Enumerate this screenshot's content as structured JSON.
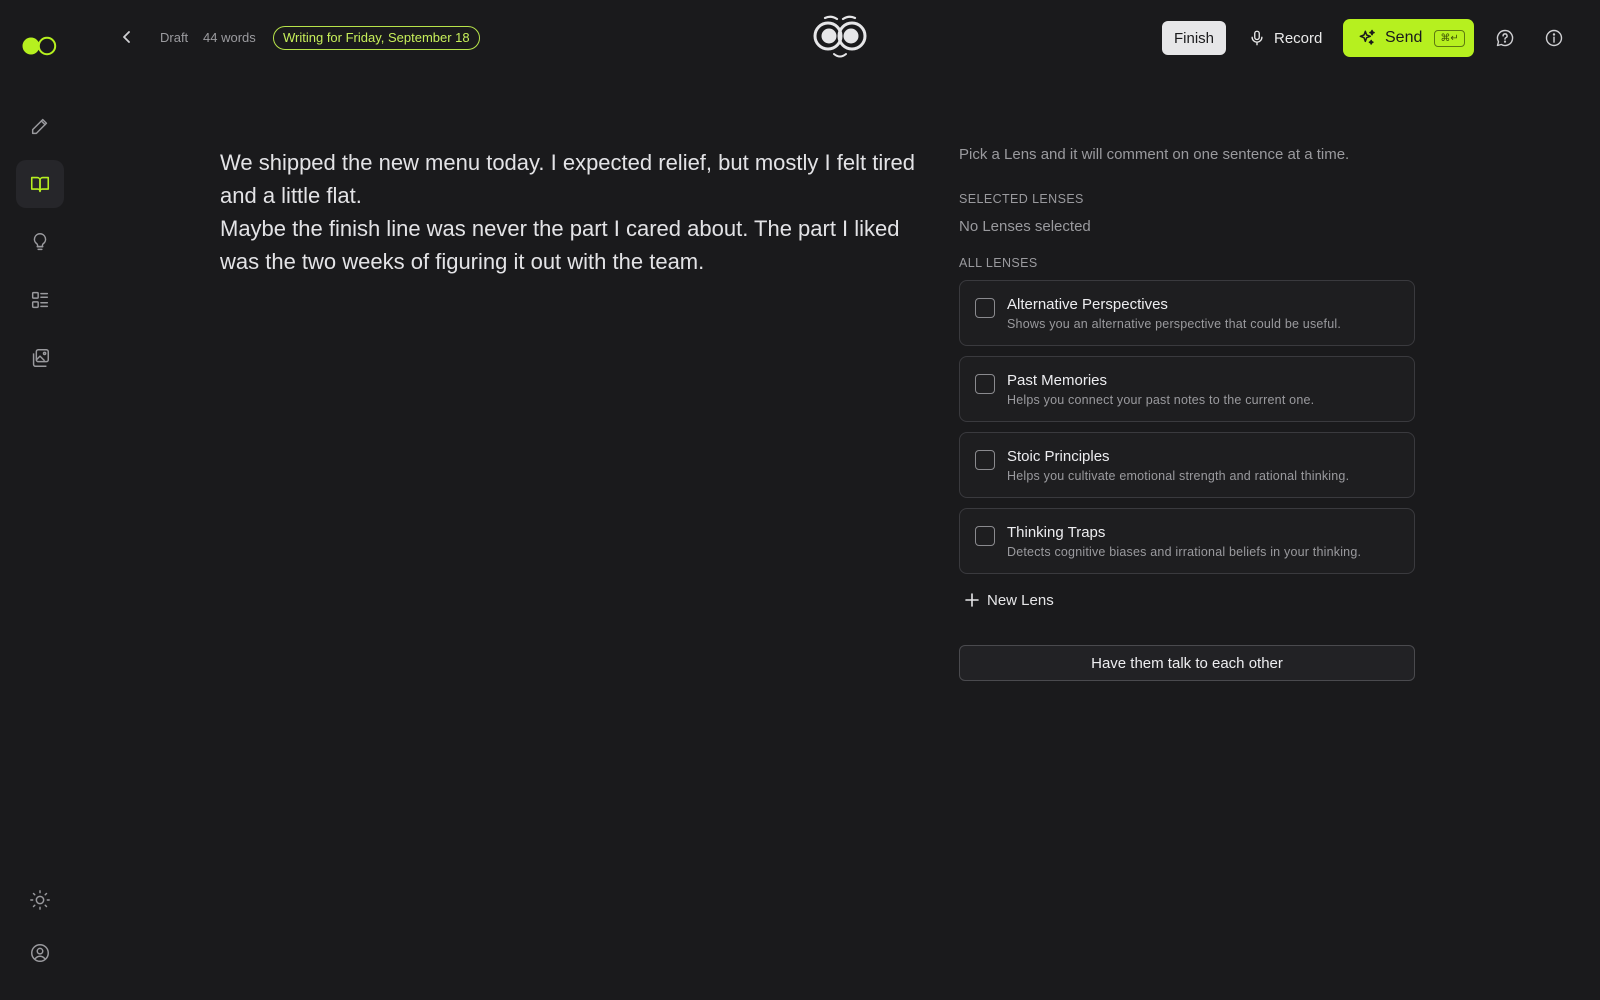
{
  "colors": {
    "background": "#1a1a1c",
    "accent": "#b6f01f",
    "accent_text": "#c7ef5a"
  },
  "sidebar": {
    "logo": "toggle-logo",
    "items": [
      {
        "icon": "pencil-icon",
        "name": "nav-write"
      },
      {
        "icon": "book-open-icon",
        "name": "nav-journal",
        "active": true
      },
      {
        "icon": "lightbulb-icon",
        "name": "nav-ideas"
      },
      {
        "icon": "list-icon",
        "name": "nav-lists"
      },
      {
        "icon": "gallery-icon",
        "name": "nav-media"
      }
    ],
    "bottom_items": [
      {
        "icon": "sun-icon",
        "name": "theme-toggle"
      },
      {
        "icon": "user-circle-icon",
        "name": "account"
      }
    ]
  },
  "header": {
    "status": "Draft",
    "word_count": "44 words",
    "date_label": "Writing for Friday, September 18",
    "finish_label": "Finish",
    "record_label": "Record",
    "send_label": "Send",
    "send_shortcut": "⌘↵"
  },
  "editor": {
    "paragraphs": [
      "We shipped the new menu today. I expected relief, but mostly I felt tired and a little flat.",
      "Maybe the finish line was never the part I cared about. The part I liked was the two weeks of figuring it out with the team."
    ]
  },
  "lenses": {
    "hint": "Pick a Lens and it will comment on one sentence at a time.",
    "selected_title": "SELECTED LENSES",
    "selected_empty": "No Lenses selected",
    "all_title": "ALL LENSES",
    "items": [
      {
        "name": "Alternative Perspectives",
        "description": "Shows you an alternative perspective that could be useful.",
        "checked": false
      },
      {
        "name": "Past Memories",
        "description": "Helps you connect your past notes to the current one.",
        "checked": false
      },
      {
        "name": "Stoic Principles",
        "description": "Helps you cultivate emotional strength and rational thinking.",
        "checked": false
      },
      {
        "name": "Thinking Traps",
        "description": "Detects cognitive biases and irrational beliefs in your thinking.",
        "checked": false
      }
    ],
    "new_lens_label": "New Lens",
    "talk_button_label": "Have them talk to each other"
  }
}
